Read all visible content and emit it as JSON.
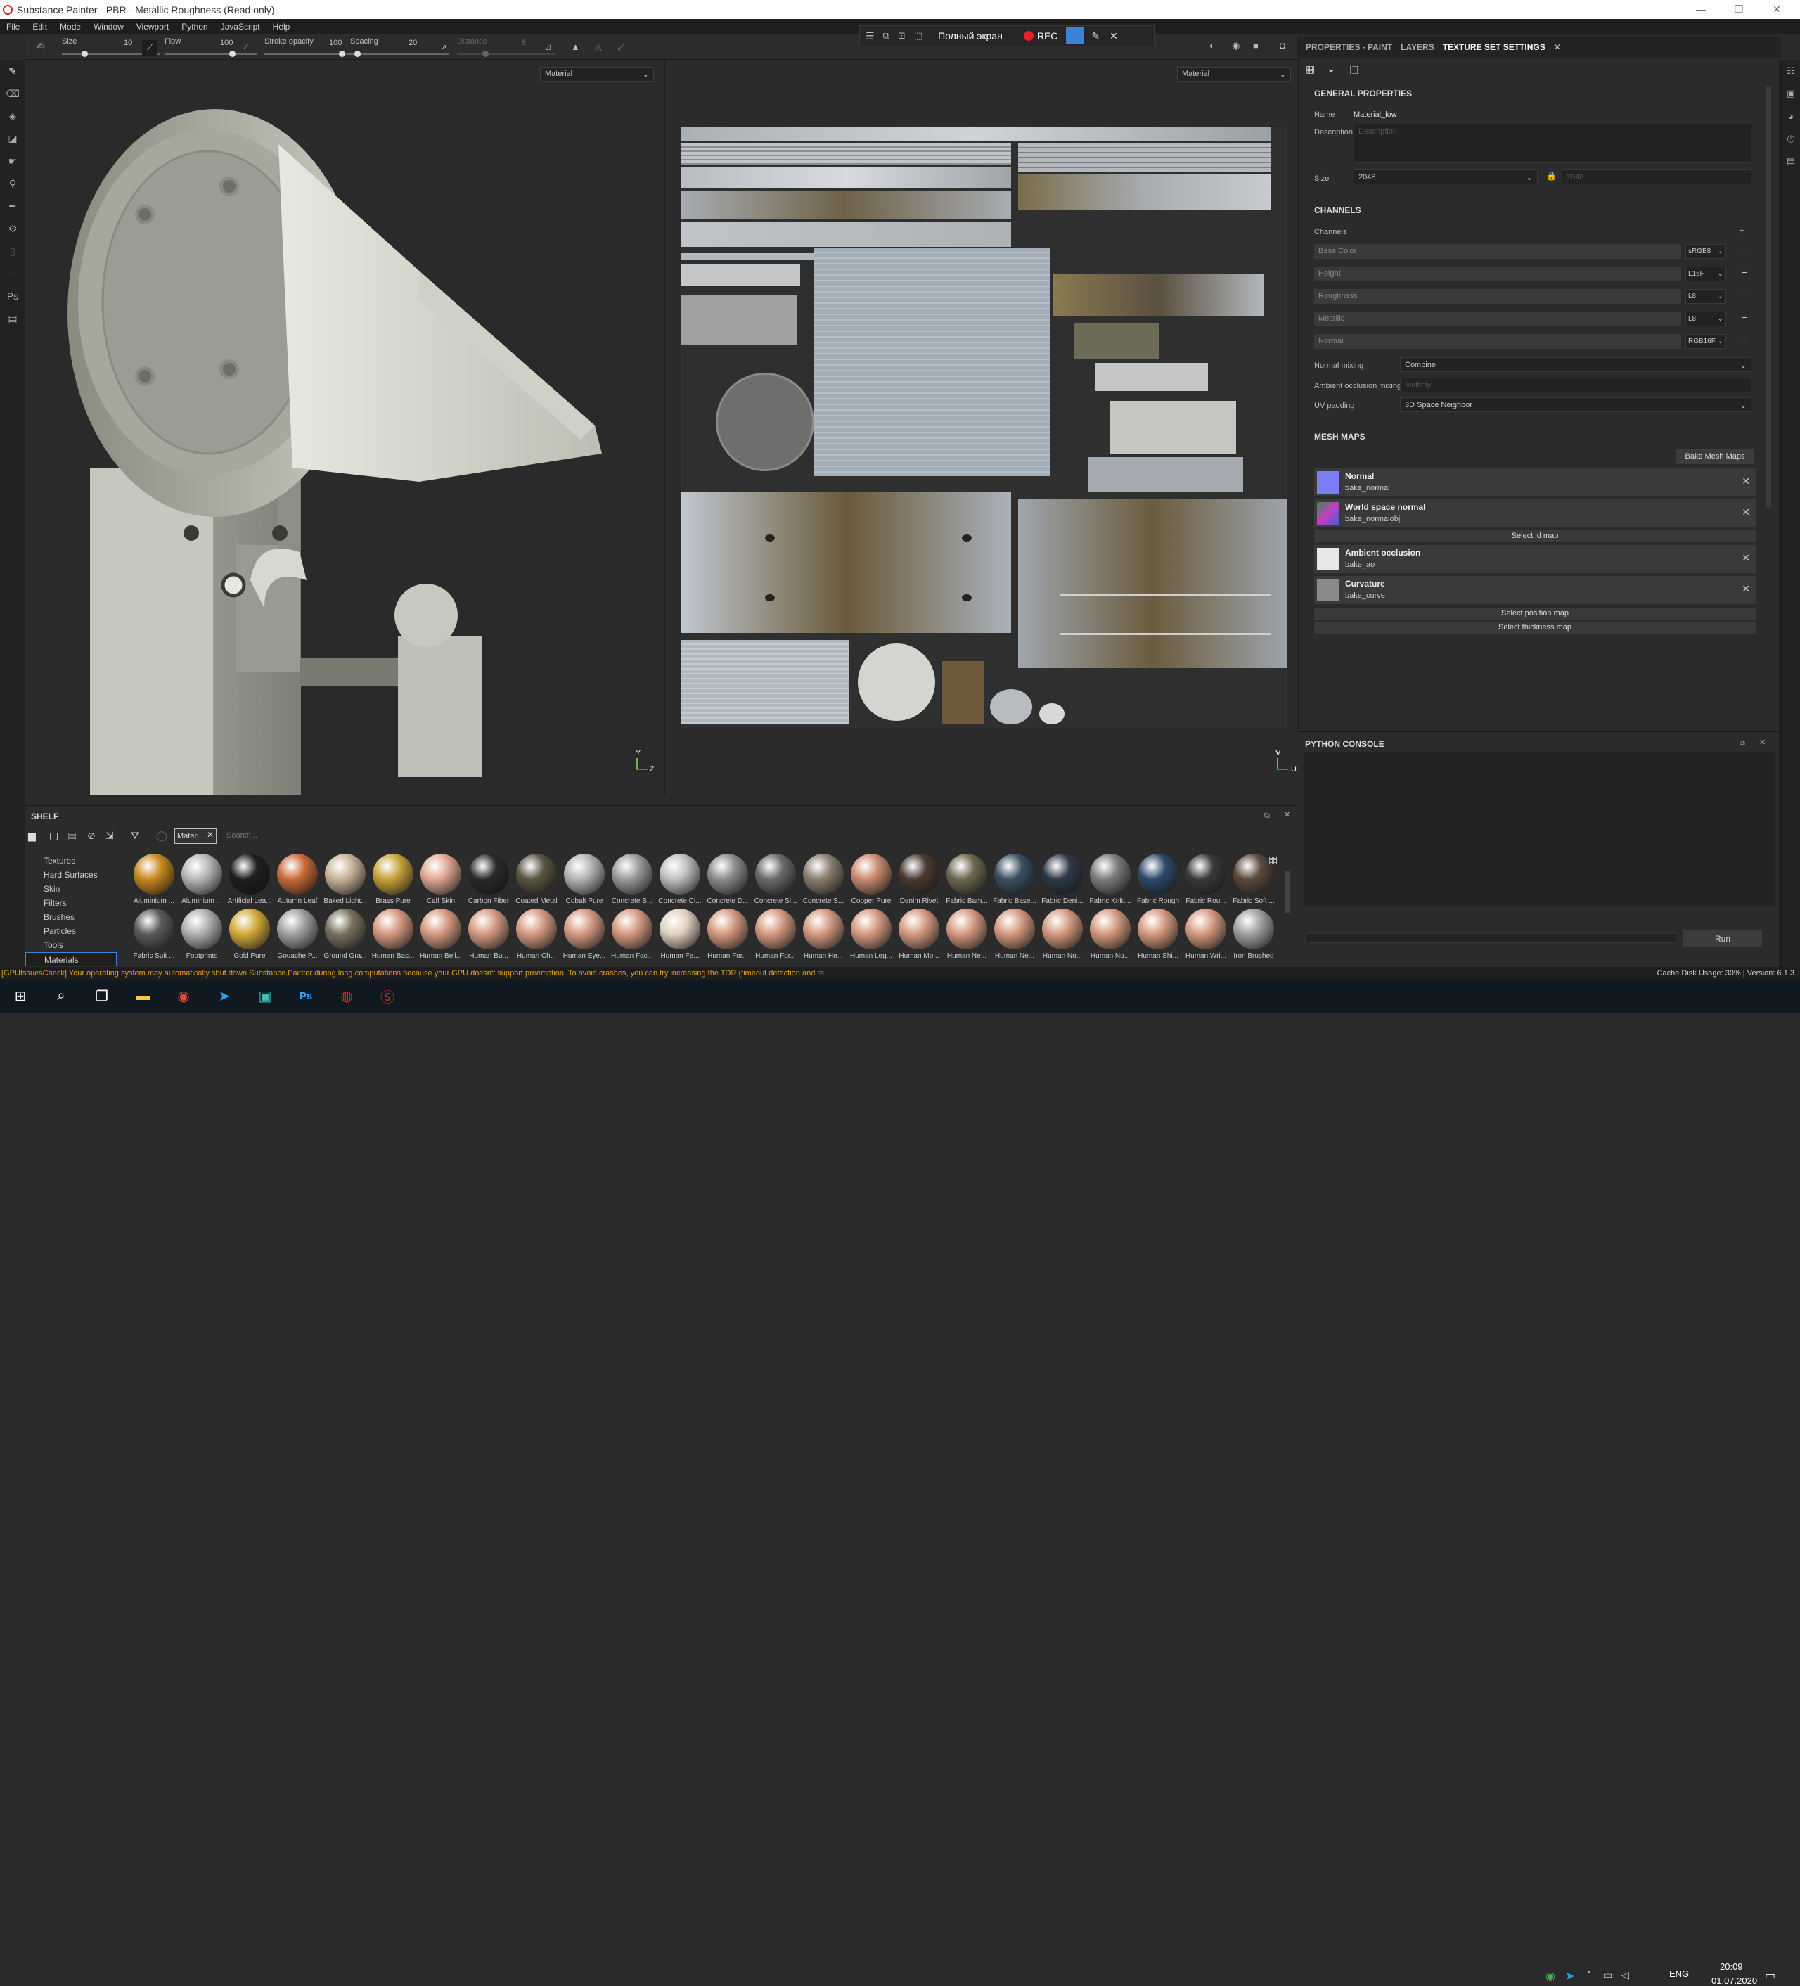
{
  "window": {
    "title": "Substance Painter - PBR - Metallic Roughness (Read only)"
  },
  "menu": [
    "File",
    "Edit",
    "Mode",
    "Window",
    "Viewport",
    "Python",
    "JavaScript",
    "Help"
  ],
  "toolbar": {
    "size_label": "Size",
    "size_value": "10",
    "flow_label": "Flow",
    "flow_value": "100",
    "opacity_label": "Stroke opacity",
    "opacity_value": "100",
    "spacing_label": "Spacing",
    "spacing_value": "20",
    "distance_label": "Distance",
    "distance_value": "8"
  },
  "recorder": {
    "fullscreen": "Полный экран",
    "rec": "REC"
  },
  "viewport3d": {
    "mode": "Material",
    "axis_v": "Y",
    "axis_h": "Z"
  },
  "viewport2d": {
    "mode": "Material",
    "axis_v": "V",
    "axis_h": "U"
  },
  "properties": {
    "tabs": [
      "PROPERTIES - PAINT",
      "LAYERS",
      "TEXTURE SET SETTINGS"
    ],
    "general_title": "GENERAL PROPERTIES",
    "name_label": "Name",
    "name_value": "Material_low",
    "desc_label": "Description",
    "desc_placeholder": "Description",
    "size_label": "Size",
    "size_value": "2048",
    "size_value2": "2048",
    "channels_title": "CHANNELS",
    "channels_label": "Channels",
    "channels": [
      {
        "name": "Base Color",
        "format": "sRGB8"
      },
      {
        "name": "Height",
        "format": "L16F"
      },
      {
        "name": "Roughness",
        "format": "L8"
      },
      {
        "name": "Metallic",
        "format": "L8"
      },
      {
        "name": "Normal",
        "format": "RGB16F"
      }
    ],
    "normal_mixing_label": "Normal mixing",
    "normal_mixing_value": "Combine",
    "ao_mixing_label": "Ambient occlusion mixing",
    "ao_mixing_value": "Multiply",
    "uv_padding_label": "UV padding",
    "uv_padding_value": "3D Space Neighbor",
    "mesh_maps_title": "MESH MAPS",
    "bake_button": "Bake Mesh Maps",
    "mesh_maps": [
      {
        "title": "Normal",
        "sub": "bake_normal",
        "color": "#7d7df5"
      },
      {
        "title": "World space normal",
        "sub": "bake_normalobj",
        "color": "#4aa05a"
      },
      {
        "title": "Ambient occlusion",
        "sub": "bake_ao",
        "color": "#e8e8e8"
      },
      {
        "title": "Curvature",
        "sub": "bake_curve",
        "color": "#8a8a8a"
      }
    ],
    "select_id": "Select id map",
    "select_position": "Select position map",
    "select_thickness": "Select thickness map"
  },
  "python": {
    "title": "PYTHON CONSOLE",
    "run": "Run"
  },
  "shelf": {
    "title": "SHELF",
    "filter_tag": "Materi..",
    "search_placeholder": "Search...",
    "categories": [
      "Textures",
      "Hard Surfaces",
      "Skin",
      "Filters",
      "Brushes",
      "Particles",
      "Tools",
      "Materials"
    ],
    "materials_row1": [
      {
        "n": "Aluminium ...",
        "c": "#c9891f"
      },
      {
        "n": "Aluminium ...",
        "c": "#b8b8b8"
      },
      {
        "n": "Artificial Lea...",
        "c": "#1e1e1e"
      },
      {
        "n": "Autumn Leaf",
        "c": "#c96a3a"
      },
      {
        "n": "Baked Light...",
        "c": "#c8b39a"
      },
      {
        "n": "Brass Pure",
        "c": "#c9a23a"
      },
      {
        "n": "Calf Skin",
        "c": "#e0a891"
      },
      {
        "n": "Carbon Fiber",
        "c": "#2a2a2a"
      },
      {
        "n": "Coated Metal",
        "c": "#5a5440"
      },
      {
        "n": "Cobalt Pure",
        "c": "#b4b4b4"
      },
      {
        "n": "Concrete B...",
        "c": "#9a9a9a"
      },
      {
        "n": "Concrete Cl...",
        "c": "#c0c0c0"
      },
      {
        "n": "Concrete D...",
        "c": "#8c8c8c"
      },
      {
        "n": "Concrete Sl...",
        "c": "#6a6a6a"
      },
      {
        "n": "Concrete S...",
        "c": "#8a7e70"
      },
      {
        "n": "Copper Pure",
        "c": "#c98a70"
      },
      {
        "n": "Denim Rivet",
        "c": "#4a3a30"
      },
      {
        "n": "Fabric Bam...",
        "c": "#6e6850"
      },
      {
        "n": "Fabric Base...",
        "c": "#3a5060"
      },
      {
        "n": "Fabric Deni...",
        "c": "#2e3a48"
      },
      {
        "n": "Fabric Knitt...",
        "c": "#7c7c7c"
      },
      {
        "n": "Fabric Rough",
        "c": "#2e4a6a"
      },
      {
        "n": "Fabric Rou...",
        "c": "#3a3a3a"
      },
      {
        "n": "Fabric Soft ...",
        "c": "#5a4a3e"
      }
    ],
    "materials_row2": [
      {
        "n": "Fabric Suit ...",
        "c": "#5a5a5a"
      },
      {
        "n": "Footprints",
        "c": "#b0b0b0"
      },
      {
        "n": "Gold Pure",
        "c": "#d4aa3a"
      },
      {
        "n": "Gouache P...",
        "c": "#a0a0a0"
      },
      {
        "n": "Ground Gra...",
        "c": "#7a7060"
      },
      {
        "n": "Human Bac...",
        "c": "#d49a80"
      },
      {
        "n": "Human Bell...",
        "c": "#d49a80"
      },
      {
        "n": "Human Bu...",
        "c": "#d49a80"
      },
      {
        "n": "Human Ch...",
        "c": "#d49a80"
      },
      {
        "n": "Human Eye...",
        "c": "#d49a80"
      },
      {
        "n": "Human Fac...",
        "c": "#d49a80"
      },
      {
        "n": "Human Fe...",
        "c": "#e0d0c0"
      },
      {
        "n": "Human For...",
        "c": "#d49a80"
      },
      {
        "n": "Human For...",
        "c": "#d49a80"
      },
      {
        "n": "Human He...",
        "c": "#d49a80"
      },
      {
        "n": "Human Leg...",
        "c": "#d49a80"
      },
      {
        "n": "Human Mo...",
        "c": "#d49a80"
      },
      {
        "n": "Human Ne...",
        "c": "#d49a80"
      },
      {
        "n": "Human Ne...",
        "c": "#d49a80"
      },
      {
        "n": "Human No...",
        "c": "#d49a80"
      },
      {
        "n": "Human No...",
        "c": "#d49a80"
      },
      {
        "n": "Human Shi...",
        "c": "#d49a80"
      },
      {
        "n": "Human Wri...",
        "c": "#d49a80"
      },
      {
        "n": "Iron Brushed",
        "c": "#a0a0a0"
      }
    ]
  },
  "status": {
    "warning": "[GPUIssuesCheck] Your operating system may automatically shut down Substance Painter during long computations because your GPU doesn't support preemption. To avoid crashes, you can try increasing the TDR (timeout detection and re...",
    "cache": "Cache Disk Usage:   30% | Version: 6.1.3"
  },
  "taskbar": {
    "lang": "ENG",
    "time": "20:09",
    "date": "01.07.2020"
  },
  "colors": {
    "accent": "#3b83d6",
    "rec": "#e8202a",
    "warning": "#e0a020"
  }
}
